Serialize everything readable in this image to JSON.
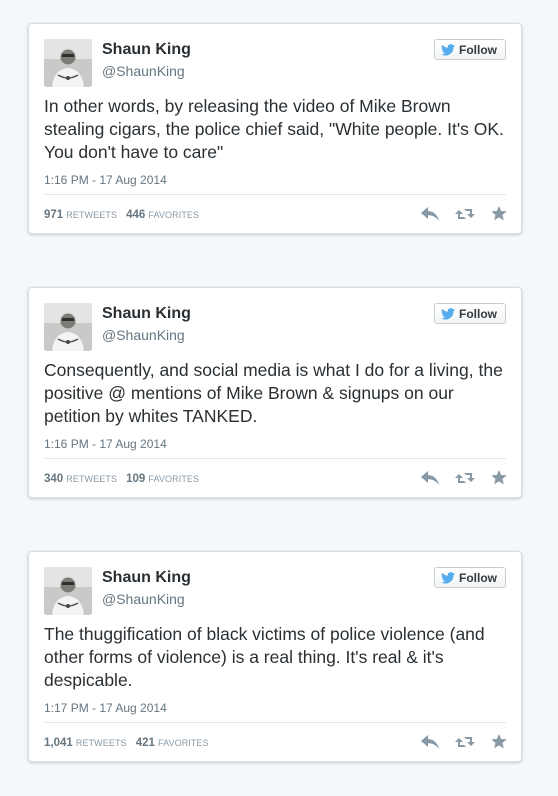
{
  "colors": {
    "background": "#f5f8fa",
    "card": "#ffffff",
    "text": "#292f33",
    "muted": "#66757f",
    "twitter_blue": "#55acee",
    "action_icon": "#8899a6"
  },
  "follow_label": "Follow",
  "tweets": [
    {
      "name": "Shaun King",
      "handle": "@ShaunKing",
      "text": "In other words, by releasing the video of Mike Brown stealing cigars, the police chief said, \"White people. It's OK. You don't have to care\"",
      "timestamp": "1:16 PM - 17 Aug 2014",
      "retweets": "971",
      "retweets_label": "RETWEETS",
      "favorites": "446",
      "favorites_label": "FAVORITES"
    },
    {
      "name": "Shaun King",
      "handle": "@ShaunKing",
      "text": "Consequently, and social media is what I do for a living, the positive @ mentions of Mike Brown & signups on our petition by whites TANKED.",
      "timestamp": "1:16 PM - 17 Aug 2014",
      "retweets": "340",
      "retweets_label": "RETWEETS",
      "favorites": "109",
      "favorites_label": "FAVORITES"
    },
    {
      "name": "Shaun King",
      "handle": "@ShaunKing",
      "text": "The thuggification of black victims of police violence (and other forms of violence) is a real thing. It's real & it's despicable.",
      "timestamp": "1:17 PM - 17 Aug 2014",
      "retweets": "1,041",
      "retweets_label": "RETWEETS",
      "favorites": "421",
      "favorites_label": "FAVORITES"
    }
  ]
}
